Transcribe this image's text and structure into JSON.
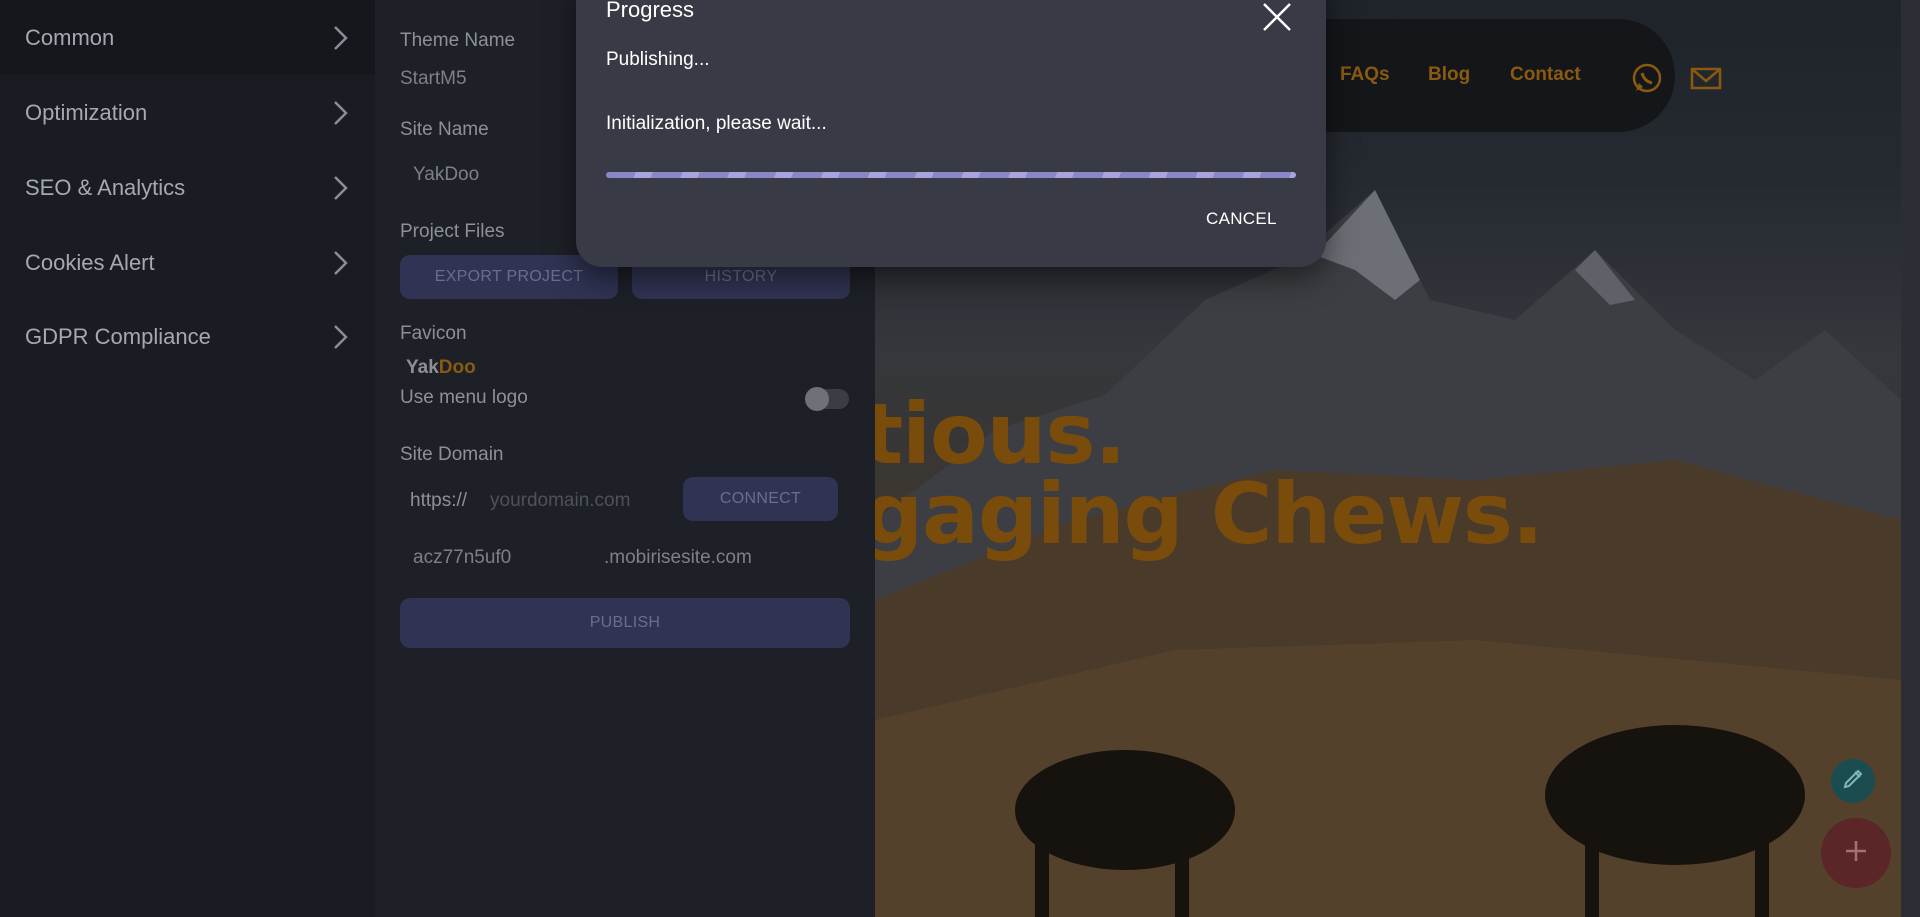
{
  "sidebar": {
    "items": [
      {
        "label": "Common"
      },
      {
        "label": "Optimization"
      },
      {
        "label": "SEO & Analytics"
      },
      {
        "label": "Cookies Alert"
      },
      {
        "label": "GDPR Compliance"
      }
    ]
  },
  "panel": {
    "theme_label": "Theme Name",
    "theme_value": "StartM5",
    "site_name_label": "Site Name",
    "site_name_value": "YakDoo",
    "project_files_label": "Project Files",
    "export_button": "EXPORT PROJECT",
    "history_button": "HISTORY",
    "favicon_label": "Favicon",
    "favicon_logo_part1": "Yak",
    "favicon_logo_part2": "Doo",
    "use_menu_logo_label": "Use menu logo",
    "use_menu_logo_on": false,
    "site_domain_label": "Site Domain",
    "domain_prefix": "https://",
    "domain_placeholder": "yourdomain.com",
    "connect_button": "CONNECT",
    "subdomain_value": "acz77n5uf0",
    "subdomain_suffix": ".mobirisesite.com",
    "publish_button": "PUBLISH"
  },
  "preview": {
    "nav_links": [
      "FAQs",
      "Blog",
      "Contact"
    ],
    "nav_icons": [
      "whatsapp-icon",
      "mail-icon"
    ],
    "hero_line1": "tious.",
    "hero_line2": "gaging Chews.",
    "accent_color": "#d98a14"
  },
  "dialog": {
    "title": "Progress",
    "status": "Publishing...",
    "message": "Initialization, please wait...",
    "cancel_label": "CANCEL"
  }
}
